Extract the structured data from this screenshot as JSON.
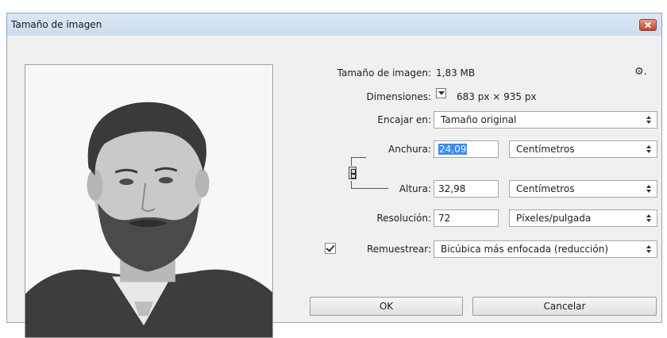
{
  "window": {
    "title": "Tamaño de imagen"
  },
  "image_size": {
    "label": "Tamaño de imagen:",
    "value": "1,83 MB"
  },
  "dimensions": {
    "label": "Dimensiones:",
    "value": "683 px × 935 px"
  },
  "fit_to": {
    "label": "Encajar en:",
    "value": "Tamaño original"
  },
  "width": {
    "label": "Anchura:",
    "value": "24,09",
    "unit": "Centímetros"
  },
  "height": {
    "label": "Altura:",
    "value": "32,98",
    "unit": "Centímetros"
  },
  "resolution": {
    "label": "Resolución:",
    "value": "72",
    "unit": "Píxeles/pulgada"
  },
  "resample": {
    "label": "Remuestrear:",
    "checked": true,
    "method": "Bicúbica más enfocada (reducción)"
  },
  "buttons": {
    "ok": "OK",
    "cancel": "Cancelar"
  },
  "icons": {
    "close": "close-icon",
    "settings": "gear-icon",
    "dimensions_toggle": "dropdown-toggle-icon",
    "constrain": "chain-link-icon"
  },
  "colors": {
    "title_bar": "#cddcee",
    "close_button": "#c4422c",
    "selection": "#3b8cf0",
    "dialog_bg": "#f0f0f0"
  }
}
